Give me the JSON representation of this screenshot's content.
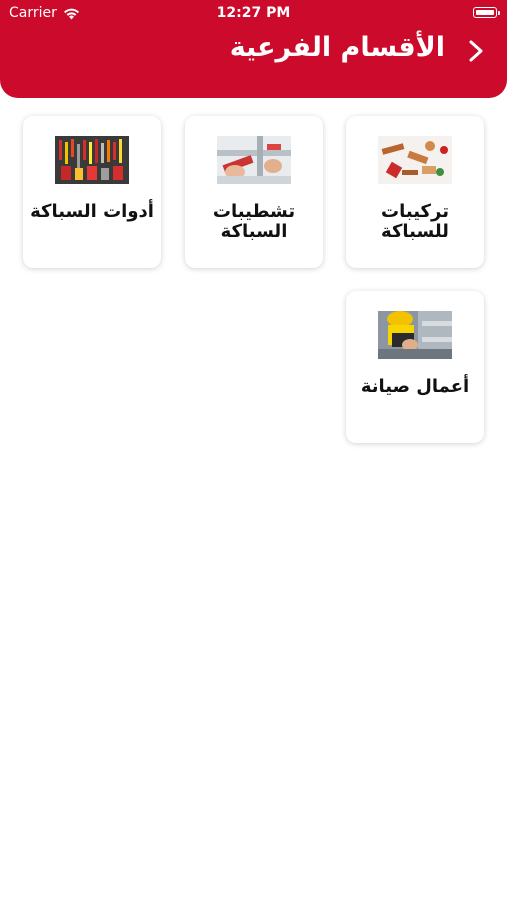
{
  "status_bar": {
    "carrier": "Carrier",
    "time": "12:27 PM"
  },
  "header": {
    "title": "الأقسام الفرعية",
    "back_icon": "chevron-right-icon",
    "background_color": "#cc0a2b"
  },
  "categories": [
    {
      "label": "تركيبات للسباكة",
      "image": "copper-fittings-image"
    },
    {
      "label": "تشطيبات السباكة",
      "image": "pipe-installation-image"
    },
    {
      "label": "أدوات السباكة",
      "image": "tools-wall-image"
    },
    {
      "label": "أعمال صيانة",
      "image": "maintenance-worker-image"
    }
  ]
}
